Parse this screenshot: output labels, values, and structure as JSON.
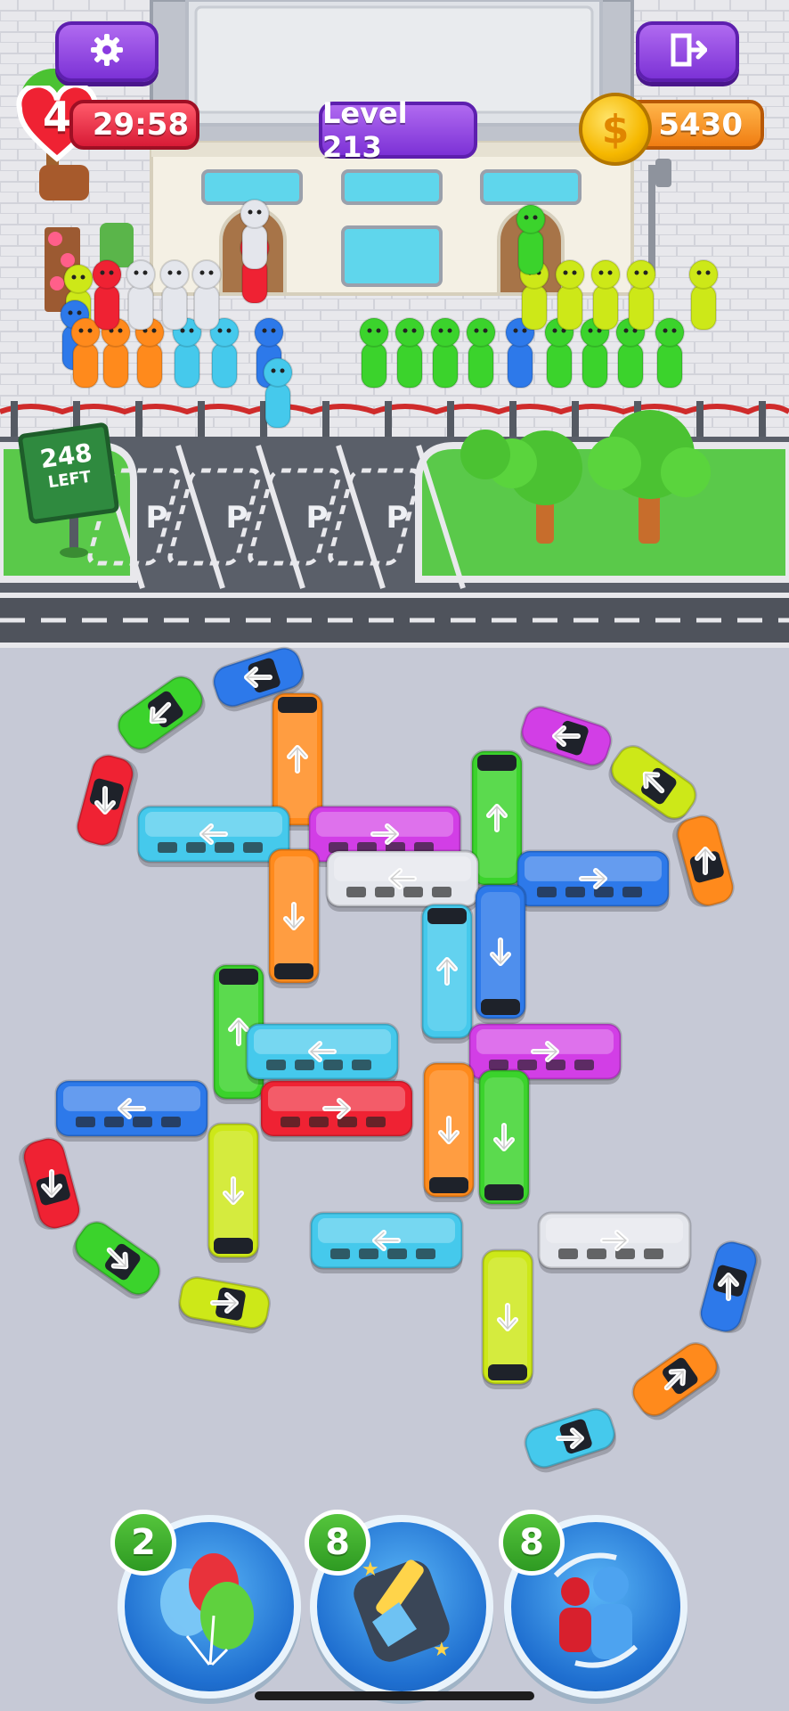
{
  "hud": {
    "lives": "4",
    "timer": "29:58",
    "level": "Level 213",
    "coins": "5430",
    "coin_symbol": "$"
  },
  "sign": {
    "count": "248",
    "label": "LEFT"
  },
  "parking": {
    "slot_label": "P"
  },
  "boosters": [
    {
      "name": "balloons",
      "count": "2"
    },
    {
      "name": "sweep",
      "count": "8"
    },
    {
      "name": "swap",
      "count": "8"
    }
  ],
  "colors": {
    "red": "#ef2233",
    "orange": "#ff8a1c",
    "yellow": "#cde818",
    "green": "#3bd32c",
    "cyan": "#45c9ec",
    "blue": "#2d79ea",
    "magenta": "#d23ee6",
    "white": "#e4e6ec"
  },
  "queue_left": [
    "yellow",
    "blue",
    "orange",
    "orange",
    "orange",
    "cyan",
    "cyan",
    "blue",
    "cyan",
    "red",
    "white",
    "white",
    "white",
    "red"
  ],
  "queue_right": [
    "green",
    "green",
    "green",
    "green",
    "blue",
    "green",
    "green",
    "green",
    "green",
    "yellow",
    "yellow",
    "yellow",
    "yellow",
    "yellow"
  ],
  "vehicles": [
    {
      "kind": "car",
      "color": "blue",
      "dir": "left"
    },
    {
      "kind": "car",
      "color": "green",
      "dir": "down-left"
    },
    {
      "kind": "car",
      "color": "red",
      "dir": "down"
    },
    {
      "kind": "bus",
      "color": "orange",
      "dir": "up"
    },
    {
      "kind": "bus",
      "color": "cyan",
      "dir": "left"
    },
    {
      "kind": "bus",
      "color": "magenta",
      "dir": "right"
    },
    {
      "kind": "bus",
      "color": "green",
      "dir": "up"
    },
    {
      "kind": "car",
      "color": "magenta",
      "dir": "left"
    },
    {
      "kind": "car",
      "color": "yellow",
      "dir": "up-left"
    },
    {
      "kind": "car",
      "color": "orange",
      "dir": "up"
    },
    {
      "kind": "bus",
      "color": "white",
      "dir": "left"
    },
    {
      "kind": "bus",
      "color": "blue",
      "dir": "right"
    },
    {
      "kind": "bus",
      "color": "orange",
      "dir": "down"
    },
    {
      "kind": "bus",
      "color": "cyan",
      "dir": "up"
    },
    {
      "kind": "bus",
      "color": "blue",
      "dir": "down"
    },
    {
      "kind": "bus",
      "color": "green",
      "dir": "up"
    },
    {
      "kind": "bus",
      "color": "cyan",
      "dir": "left"
    },
    {
      "kind": "bus",
      "color": "magenta",
      "dir": "right"
    },
    {
      "kind": "bus",
      "color": "blue",
      "dir": "left"
    },
    {
      "kind": "bus",
      "color": "red",
      "dir": "right"
    },
    {
      "kind": "bus",
      "color": "orange",
      "dir": "down"
    },
    {
      "kind": "bus",
      "color": "green",
      "dir": "down"
    },
    {
      "kind": "bus",
      "color": "yellow",
      "dir": "down"
    },
    {
      "kind": "bus",
      "color": "cyan",
      "dir": "left"
    },
    {
      "kind": "bus",
      "color": "white",
      "dir": "right"
    },
    {
      "kind": "bus",
      "color": "yellow",
      "dir": "down"
    },
    {
      "kind": "car",
      "color": "red",
      "dir": "down"
    },
    {
      "kind": "car",
      "color": "green",
      "dir": "down-right"
    },
    {
      "kind": "car",
      "color": "yellow",
      "dir": "right"
    },
    {
      "kind": "car",
      "color": "blue",
      "dir": "up"
    },
    {
      "kind": "car",
      "color": "orange",
      "dir": "up-right"
    },
    {
      "kind": "car",
      "color": "cyan",
      "dir": "right"
    }
  ]
}
